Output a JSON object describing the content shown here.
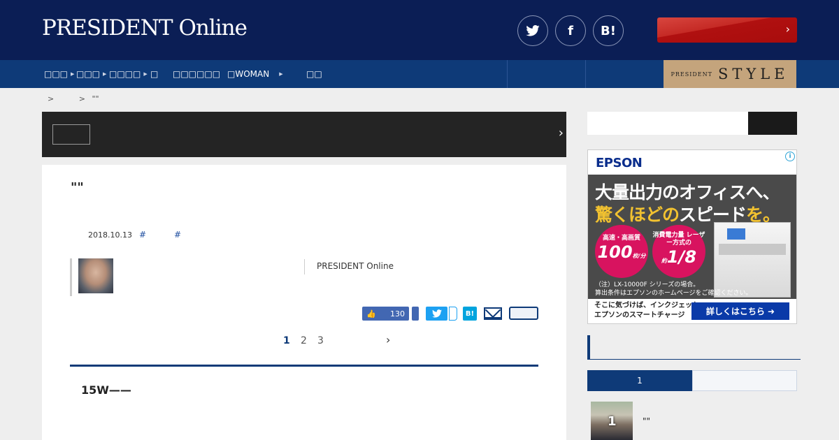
{
  "header": {
    "logo": "PRESIDENT Online",
    "social": [
      {
        "name": "twitter-icon",
        "glyph": "t"
      },
      {
        "name": "facebook-icon",
        "glyph": "f"
      },
      {
        "name": "hatena-icon",
        "glyph": "B!"
      }
    ]
  },
  "nav": {
    "items": [
      {
        "label": "□□□"
      },
      {
        "label": "□□□"
      },
      {
        "label": "□□□□"
      },
      {
        "label": "□"
      },
      {
        "label": "□□□□□□"
      },
      {
        "label": "□WOMAN"
      },
      {
        "label": "□□"
      }
    ],
    "style_banner": {
      "small": "PRESIDENT",
      "big": "STYLE"
    }
  },
  "breadcrumb": {
    "sep1": ">",
    "sep2": ">",
    "current": "\"\""
  },
  "article": {
    "title": "\"\"",
    "date": "2018.10.13",
    "tags": [
      "#",
      "#"
    ],
    "source": "PRESIDENT Online",
    "like_count": "130",
    "pages": [
      "1",
      "2",
      "3"
    ],
    "lead": "15W——"
  },
  "ad": {
    "brand": "EPSON",
    "info": "i",
    "headline1": "大量出力のオフィスへ、",
    "headline2_a": "驚くほどの",
    "headline2_b": "スピード",
    "headline2_c": "を。",
    "circle1_small": "高速・高画質",
    "circle1_big": "100",
    "circle1_unit": "枚/分",
    "circle2_small": "消費電力量 レーザー方式の",
    "circle2_big": "1/8",
    "circle2_unit": "約",
    "note1": "（注）LX-10000F シリーズの場合。",
    "note2": "算出条件はエプソンのホームページをご確認ください。",
    "bottom_line1": "そこに気づけば、インクジェット。",
    "bottom_line2": "エプソンのスマートチャージ",
    "cta": "詳しくはこちら ➜"
  },
  "ranking": {
    "tab_active": "1",
    "item_rank": "1",
    "item_title": "\"\""
  }
}
